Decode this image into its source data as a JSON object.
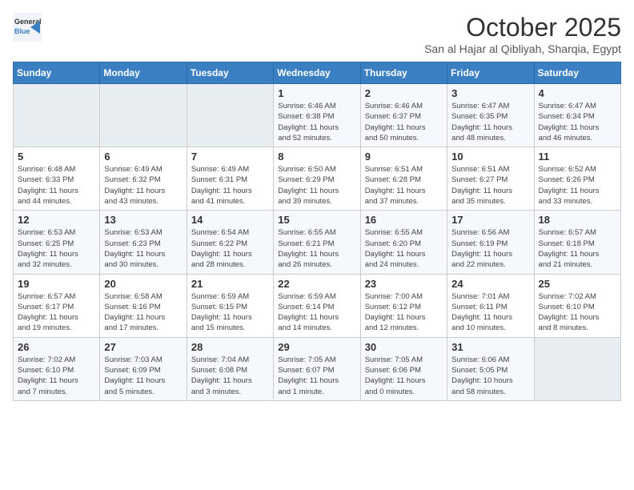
{
  "header": {
    "logo_general": "General",
    "logo_blue": "Blue",
    "month": "October 2025",
    "location": "San al Hajar al Qibliyah, Sharqia, Egypt"
  },
  "weekdays": [
    "Sunday",
    "Monday",
    "Tuesday",
    "Wednesday",
    "Thursday",
    "Friday",
    "Saturday"
  ],
  "weeks": [
    [
      {
        "day": "",
        "info": ""
      },
      {
        "day": "",
        "info": ""
      },
      {
        "day": "",
        "info": ""
      },
      {
        "day": "1",
        "info": "Sunrise: 6:46 AM\nSunset: 6:38 PM\nDaylight: 11 hours\nand 52 minutes."
      },
      {
        "day": "2",
        "info": "Sunrise: 6:46 AM\nSunset: 6:37 PM\nDaylight: 11 hours\nand 50 minutes."
      },
      {
        "day": "3",
        "info": "Sunrise: 6:47 AM\nSunset: 6:35 PM\nDaylight: 11 hours\nand 48 minutes."
      },
      {
        "day": "4",
        "info": "Sunrise: 6:47 AM\nSunset: 6:34 PM\nDaylight: 11 hours\nand 46 minutes."
      }
    ],
    [
      {
        "day": "5",
        "info": "Sunrise: 6:48 AM\nSunset: 6:33 PM\nDaylight: 11 hours\nand 44 minutes."
      },
      {
        "day": "6",
        "info": "Sunrise: 6:49 AM\nSunset: 6:32 PM\nDaylight: 11 hours\nand 43 minutes."
      },
      {
        "day": "7",
        "info": "Sunrise: 6:49 AM\nSunset: 6:31 PM\nDaylight: 11 hours\nand 41 minutes."
      },
      {
        "day": "8",
        "info": "Sunrise: 6:50 AM\nSunset: 6:29 PM\nDaylight: 11 hours\nand 39 minutes."
      },
      {
        "day": "9",
        "info": "Sunrise: 6:51 AM\nSunset: 6:28 PM\nDaylight: 11 hours\nand 37 minutes."
      },
      {
        "day": "10",
        "info": "Sunrise: 6:51 AM\nSunset: 6:27 PM\nDaylight: 11 hours\nand 35 minutes."
      },
      {
        "day": "11",
        "info": "Sunrise: 6:52 AM\nSunset: 6:26 PM\nDaylight: 11 hours\nand 33 minutes."
      }
    ],
    [
      {
        "day": "12",
        "info": "Sunrise: 6:53 AM\nSunset: 6:25 PM\nDaylight: 11 hours\nand 32 minutes."
      },
      {
        "day": "13",
        "info": "Sunrise: 6:53 AM\nSunset: 6:23 PM\nDaylight: 11 hours\nand 30 minutes."
      },
      {
        "day": "14",
        "info": "Sunrise: 6:54 AM\nSunset: 6:22 PM\nDaylight: 11 hours\nand 28 minutes."
      },
      {
        "day": "15",
        "info": "Sunrise: 6:55 AM\nSunset: 6:21 PM\nDaylight: 11 hours\nand 26 minutes."
      },
      {
        "day": "16",
        "info": "Sunrise: 6:55 AM\nSunset: 6:20 PM\nDaylight: 11 hours\nand 24 minutes."
      },
      {
        "day": "17",
        "info": "Sunrise: 6:56 AM\nSunset: 6:19 PM\nDaylight: 11 hours\nand 22 minutes."
      },
      {
        "day": "18",
        "info": "Sunrise: 6:57 AM\nSunset: 6:18 PM\nDaylight: 11 hours\nand 21 minutes."
      }
    ],
    [
      {
        "day": "19",
        "info": "Sunrise: 6:57 AM\nSunset: 6:17 PM\nDaylight: 11 hours\nand 19 minutes."
      },
      {
        "day": "20",
        "info": "Sunrise: 6:58 AM\nSunset: 6:16 PM\nDaylight: 11 hours\nand 17 minutes."
      },
      {
        "day": "21",
        "info": "Sunrise: 6:59 AM\nSunset: 6:15 PM\nDaylight: 11 hours\nand 15 minutes."
      },
      {
        "day": "22",
        "info": "Sunrise: 6:59 AM\nSunset: 6:14 PM\nDaylight: 11 hours\nand 14 minutes."
      },
      {
        "day": "23",
        "info": "Sunrise: 7:00 AM\nSunset: 6:12 PM\nDaylight: 11 hours\nand 12 minutes."
      },
      {
        "day": "24",
        "info": "Sunrise: 7:01 AM\nSunset: 6:11 PM\nDaylight: 11 hours\nand 10 minutes."
      },
      {
        "day": "25",
        "info": "Sunrise: 7:02 AM\nSunset: 6:10 PM\nDaylight: 11 hours\nand 8 minutes."
      }
    ],
    [
      {
        "day": "26",
        "info": "Sunrise: 7:02 AM\nSunset: 6:10 PM\nDaylight: 11 hours\nand 7 minutes."
      },
      {
        "day": "27",
        "info": "Sunrise: 7:03 AM\nSunset: 6:09 PM\nDaylight: 11 hours\nand 5 minutes."
      },
      {
        "day": "28",
        "info": "Sunrise: 7:04 AM\nSunset: 6:08 PM\nDaylight: 11 hours\nand 3 minutes."
      },
      {
        "day": "29",
        "info": "Sunrise: 7:05 AM\nSunset: 6:07 PM\nDaylight: 11 hours\nand 1 minute."
      },
      {
        "day": "30",
        "info": "Sunrise: 7:05 AM\nSunset: 6:06 PM\nDaylight: 11 hours\nand 0 minutes."
      },
      {
        "day": "31",
        "info": "Sunrise: 6:06 AM\nSunset: 5:05 PM\nDaylight: 10 hours\nand 58 minutes."
      },
      {
        "day": "",
        "info": ""
      }
    ]
  ]
}
